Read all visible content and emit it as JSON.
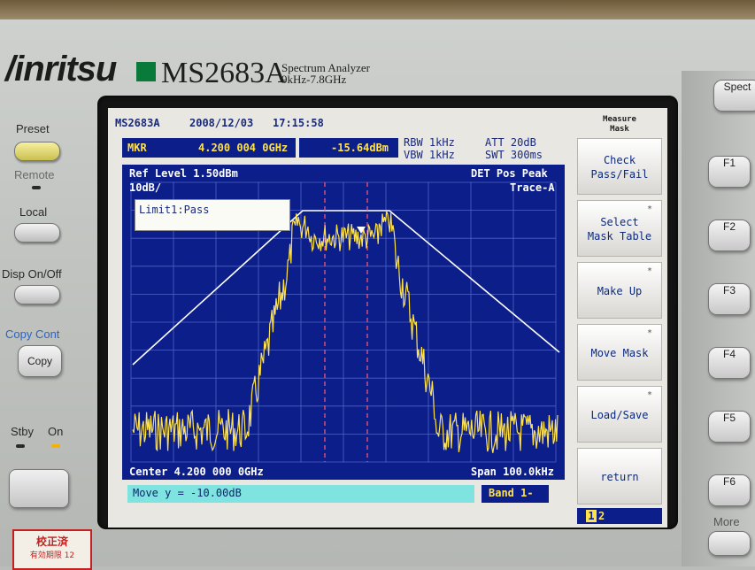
{
  "instrument": {
    "brand": "/inritsu",
    "model": "MS2683A",
    "subtitle_line1": "Spectrum Analyzer",
    "subtitle_line2": "9kHz-7.8GHz"
  },
  "left_panel": {
    "preset_label": "Preset",
    "remote_label": "Remote",
    "local_label": "Local",
    "disp_label": "Disp  On/Off",
    "copy_cont_label": "Copy  Cont",
    "copy_button": "Copy",
    "stby_label": "Stby",
    "on_label": "On",
    "sticker_line1": "校正済",
    "sticker_line2": "有効期限 12"
  },
  "screen": {
    "header": {
      "model": "MS2683A",
      "date": "2008/12/03",
      "time": "17:15:58"
    },
    "marker": {
      "label": "MKR",
      "freq": "4.200 004 0GHz",
      "level": "-15.64dBm"
    },
    "settings": {
      "rbw": "RBW  1kHz",
      "vbw": "VBW  1kHz",
      "att": "ATT  20dB",
      "swt": "SWT  300ms"
    },
    "graph": {
      "ref_level": "Ref Level   1.50dBm",
      "scale": "10dB/",
      "det": "DET   Pos Peak",
      "trace": "Trace-A",
      "limit_status": "Limit1:Pass",
      "center": "Center 4.200 000 0GHz",
      "span": "Span 100.0kHz"
    },
    "message": "Move y = -10.00dB",
    "band": "Band 1-"
  },
  "softkeys": {
    "header_line1": "Measure",
    "header_line2": "Mask",
    "keys": [
      {
        "line1": "Check",
        "line2": "Pass/Fail",
        "star": ""
      },
      {
        "line1": "Select",
        "line2": "Mask Table",
        "star": "*"
      },
      {
        "line1": "Make Up",
        "line2": "",
        "star": "*"
      },
      {
        "line1": "Move Mask",
        "line2": "",
        "star": "*"
      },
      {
        "line1": "Load/Save",
        "line2": "",
        "star": "*"
      },
      {
        "line1": "return",
        "line2": "",
        "star": ""
      }
    ],
    "page_current": "1",
    "page_other": "2"
  },
  "right_panel": {
    "spect_button": "Spect",
    "f_keys": [
      "F1",
      "F2",
      "F3",
      "F4",
      "F5",
      "F6"
    ],
    "more_label": "More"
  },
  "colors": {
    "graph_bg": "#0c1e8a",
    "trace": "#ffe24a",
    "mask": "#ffffff",
    "marker_lines": "#ff5a7a",
    "message_bg": "#7fe3df"
  }
}
